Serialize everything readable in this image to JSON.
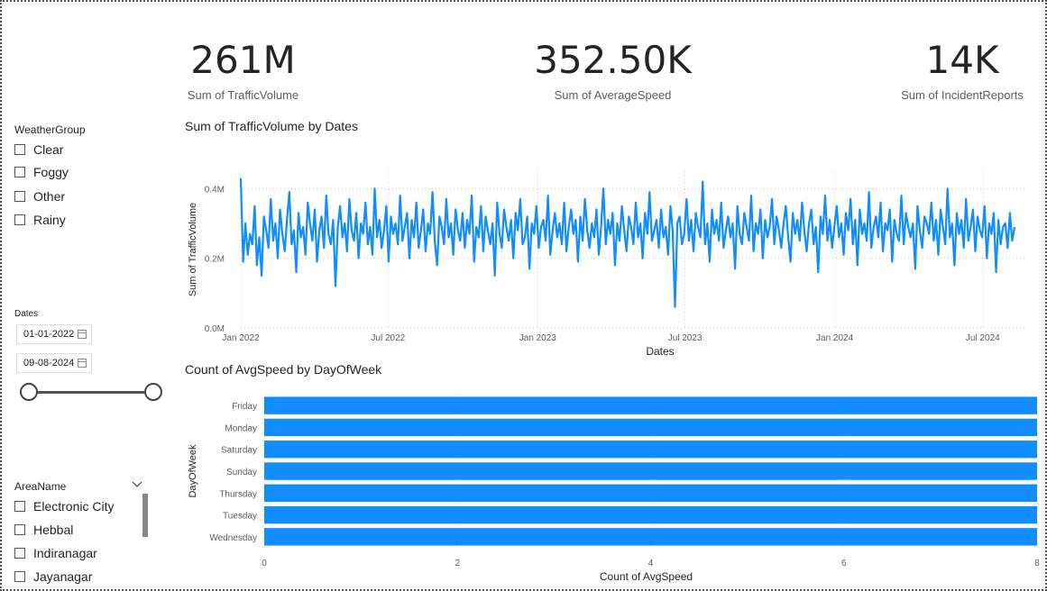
{
  "kpis": [
    {
      "value": "261M",
      "label": "Sum of TrafficVolume"
    },
    {
      "value": "352.50K",
      "label": "Sum of AverageSpeed"
    },
    {
      "value": "14K",
      "label": "Sum of IncidentReports"
    }
  ],
  "weather_slicer": {
    "title": "WeatherGroup",
    "items": [
      "Clear",
      "Foggy",
      "Other",
      "Rainy"
    ]
  },
  "date_slicer": {
    "title": "Dates",
    "start": "01-01-2022",
    "end": "09-08-2024",
    "start_fraction": 0,
    "end_fraction": 1
  },
  "area_slicer": {
    "title": "AreaName",
    "items": [
      "Electronic City",
      "Hebbal",
      "Indiranagar",
      "Jayanagar"
    ]
  },
  "line_chart_title": "Sum of TrafficVolume by Dates",
  "bar_chart_title": "Count of AvgSpeed by DayOfWeek",
  "colors": {
    "series": "#118DFF",
    "grid": "#c8c6c4",
    "text": "#605e5c"
  },
  "chart_data": [
    {
      "type": "line",
      "title": "Sum of TrafficVolume by Dates",
      "xlabel": "Dates",
      "ylabel": "Sum of TrafficVolume",
      "x_range": [
        "2022-01-01",
        "2024-08-09"
      ],
      "x_ticks": [
        "Jan 2022",
        "Jul 2022",
        "Jan 2023",
        "Jul 2023",
        "Jan 2024",
        "Jul 2024"
      ],
      "y_ticks": [
        "0.0M",
        "0.2M",
        "0.4M"
      ],
      "ylim": [
        0,
        450000
      ],
      "grid": true,
      "series": [
        {
          "values": [
            430000,
            190000,
            300000,
            210000,
            270000,
            240000,
            350000,
            180000,
            260000,
            150000,
            320000,
            280000,
            230000,
            370000,
            250000,
            300000,
            200000,
            340000,
            270000,
            220000,
            310000,
            390000,
            240000,
            280000,
            160000,
            330000,
            260000,
            290000,
            210000,
            360000,
            300000,
            250000,
            340000,
            190000,
            280000,
            320000,
            230000,
            380000,
            270000,
            240000,
            310000,
            120000,
            290000,
            350000,
            260000,
            300000,
            220000,
            370000,
            280000,
            250000,
            330000,
            200000,
            300000,
            270000,
            360000,
            240000,
            290000,
            210000,
            400000,
            260000,
            310000,
            230000,
            280000,
            350000,
            190000,
            320000,
            270000,
            300000,
            240000,
            380000,
            250000,
            290000,
            330000,
            200000,
            310000,
            260000,
            360000,
            230000,
            280000,
            340000,
            220000,
            300000,
            270000,
            390000,
            250000,
            180000,
            320000,
            290000,
            240000,
            370000,
            260000,
            300000,
            210000,
            340000,
            280000,
            250000,
            330000,
            230000,
            310000,
            270000,
            380000,
            190000,
            290000,
            260000,
            350000,
            220000,
            320000,
            280000,
            240000,
            300000,
            150000,
            360000,
            270000,
            230000,
            340000,
            290000,
            250000,
            310000,
            200000,
            330000,
            280000,
            370000,
            240000,
            260000,
            320000,
            170000,
            300000,
            270000,
            350000,
            230000,
            290000,
            310000,
            250000,
            380000,
            210000,
            280000,
            330000,
            260000,
            300000,
            240000,
            360000,
            220000,
            290000,
            340000,
            270000,
            310000,
            190000,
            320000,
            250000,
            370000,
            280000,
            230000,
            300000,
            260000,
            340000,
            210000,
            290000,
            400000,
            240000,
            310000,
            270000,
            330000,
            180000,
            300000,
            250000,
            350000,
            280000,
            220000,
            320000,
            290000,
            240000,
            360000,
            260000,
            300000,
            200000,
            330000,
            270000,
            390000,
            250000,
            280000,
            310000,
            230000,
            340000,
            260000,
            290000,
            210000,
            350000,
            280000,
            60000,
            300000,
            320000,
            240000,
            270000,
            370000,
            250000,
            310000,
            220000,
            330000,
            290000,
            260000,
            420000,
            240000,
            300000,
            190000,
            340000,
            270000,
            310000,
            250000,
            360000,
            230000,
            280000,
            320000,
            260000,
            300000,
            170000,
            350000,
            270000,
            240000,
            330000,
            290000,
            250000,
            380000,
            220000,
            300000,
            270000,
            340000,
            200000,
            310000,
            260000,
            290000,
            370000,
            240000,
            320000,
            280000,
            230000,
            300000,
            350000,
            260000,
            190000,
            330000,
            270000,
            310000,
            250000,
            360000,
            280000,
            220000,
            300000,
            340000,
            240000,
            290000,
            160000,
            320000,
            270000,
            380000,
            250000,
            310000,
            230000,
            290000,
            350000,
            260000,
            300000,
            210000,
            330000,
            280000,
            370000,
            240000,
            310000,
            180000,
            340000,
            270000,
            300000,
            250000,
            390000,
            230000,
            290000,
            320000,
            260000,
            360000,
            220000,
            300000,
            280000,
            340000,
            190000,
            310000,
            270000,
            250000,
            380000,
            240000,
            330000,
            290000,
            260000,
            300000,
            170000,
            350000,
            280000,
            230000,
            320000,
            300000,
            270000,
            360000,
            250000,
            310000,
            210000,
            340000,
            290000,
            240000,
            400000,
            260000,
            300000,
            180000,
            330000,
            270000,
            310000,
            230000,
            370000,
            250000,
            290000,
            340000,
            220000,
            320000,
            280000,
            260000,
            350000,
            200000,
            300000,
            270000,
            330000,
            160000,
            310000,
            240000,
            290000,
            300000,
            230000,
            330000,
            250000,
            290000
          ]
        }
      ]
    },
    {
      "type": "bar",
      "orientation": "horizontal",
      "title": "Count of AvgSpeed by DayOfWeek",
      "xlabel": "Count of AvgSpeed",
      "ylabel": "DayOfWeek",
      "categories": [
        "Friday",
        "Monday",
        "Saturday",
        "Sunday",
        "Thursday",
        "Tuesday",
        "Wednesday"
      ],
      "values": [
        8,
        8,
        8,
        8,
        8,
        8,
        8
      ],
      "xlim": [
        0,
        8
      ],
      "x_ticks": [
        0,
        2,
        4,
        6,
        8
      ],
      "grid": true
    }
  ]
}
